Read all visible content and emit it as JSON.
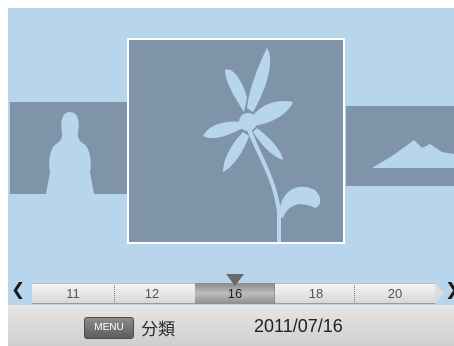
{
  "photos": [
    {
      "name": "person",
      "selected": false
    },
    {
      "name": "flower",
      "selected": true
    },
    {
      "name": "mountain",
      "selected": false
    }
  ],
  "timeline": {
    "days": [
      "11",
      "12",
      "16",
      "18",
      "20"
    ],
    "selected_day": "16"
  },
  "bottom_bar": {
    "menu_label": "MENU",
    "category_label": "分類",
    "date": "2011/07/16"
  },
  "colors": {
    "background": "#b7d5ed",
    "thumbnail": "#7f93a9",
    "silhouette": "#b7d5ed"
  }
}
